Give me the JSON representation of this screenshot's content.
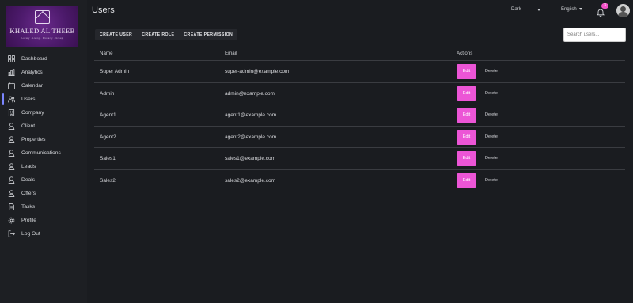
{
  "brand": {
    "title": "KHALED AL THEEB",
    "subtitle": "Luxury · Living · Property · Group"
  },
  "sidebar": {
    "items": [
      {
        "label": "Dashboard",
        "icon": "grid-icon"
      },
      {
        "label": "Analytics",
        "icon": "bar-chart-icon"
      },
      {
        "label": "Calendar",
        "icon": "calendar-icon"
      },
      {
        "label": "Users",
        "icon": "users-icon",
        "active": true
      },
      {
        "label": "Company",
        "icon": "building-icon"
      },
      {
        "label": "Client",
        "icon": "user-icon"
      },
      {
        "label": "Properties",
        "icon": "user-icon"
      },
      {
        "label": "Communications",
        "icon": "user-icon"
      },
      {
        "label": "Leads",
        "icon": "user-icon"
      },
      {
        "label": "Deals",
        "icon": "user-icon"
      },
      {
        "label": "Offers",
        "icon": "user-icon"
      },
      {
        "label": "Tasks",
        "icon": "document-icon"
      },
      {
        "label": "Profile",
        "icon": "gear-icon"
      },
      {
        "label": "Log Out",
        "icon": "logout-icon"
      }
    ]
  },
  "header": {
    "title": "Users",
    "theme": "Dark",
    "language": "English",
    "notification_count": "3"
  },
  "toolbar": {
    "create_user": "CREATE USER",
    "create_role": "CREATE ROLE",
    "create_permission": "CREATE PERMISSION",
    "search_placeholder": "Search users..."
  },
  "table": {
    "headers": {
      "name": "Name",
      "email": "Email",
      "actions": "Actions"
    },
    "edit_label": "Edit",
    "delete_label": "Delete",
    "rows": [
      {
        "name": "Super Admin",
        "email": "super-admin@example.com"
      },
      {
        "name": "Admin",
        "email": "admin@example.com"
      },
      {
        "name": "Agent1",
        "email": "agent1@example.com"
      },
      {
        "name": "Agent2",
        "email": "agent2@example.com"
      },
      {
        "name": "Sales1",
        "email": "sales1@example.com"
      },
      {
        "name": "Sales2",
        "email": "sales2@example.com"
      }
    ]
  },
  "colors": {
    "accent": "#ec55d6",
    "active_indicator": "#7b86ff",
    "background": "#1a1c20"
  }
}
